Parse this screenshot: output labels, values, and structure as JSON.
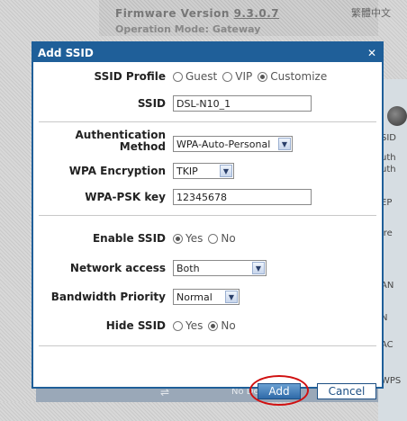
{
  "background": {
    "firmware_label": "Firmware Version",
    "firmware_version": "9.3.0.7",
    "operation_mode": "Operation Mode: Gateway",
    "language": "繁體中文",
    "right_labels": [
      "SID",
      "uth",
      "uth",
      "EP",
      "ire",
      "AN",
      "N",
      "AC",
      "WPS"
    ],
    "no_device": "No Device"
  },
  "dialog": {
    "title": "Add SSID",
    "close_symbol": "✕",
    "ssid_profile": {
      "label": "SSID Profile",
      "options": [
        "Guest",
        "VIP",
        "Customize"
      ],
      "selected": "Customize"
    },
    "ssid": {
      "label": "SSID",
      "value": "DSL-N10_1"
    },
    "auth_method": {
      "label_line1": "Authentication",
      "label_line2": "Method",
      "value": "WPA-Auto-Personal"
    },
    "wpa_encryption": {
      "label": "WPA Encryption",
      "value": "TKIP"
    },
    "wpa_psk_key": {
      "label": "WPA-PSK key",
      "value": "12345678"
    },
    "enable_ssid": {
      "label": "Enable SSID",
      "options": [
        "Yes",
        "No"
      ],
      "selected": "Yes"
    },
    "network_access": {
      "label": "Network access",
      "value": "Both"
    },
    "bandwidth_priority": {
      "label": "Bandwidth Priority",
      "value": "Normal"
    },
    "hide_ssid": {
      "label": "Hide SSID",
      "options": [
        "Yes",
        "No"
      ],
      "selected": "No"
    },
    "buttons": {
      "add": "Add",
      "cancel": "Cancel"
    }
  },
  "colors": {
    "dialog_frame": "#1f5f99",
    "highlight_ring": "#d01010"
  }
}
